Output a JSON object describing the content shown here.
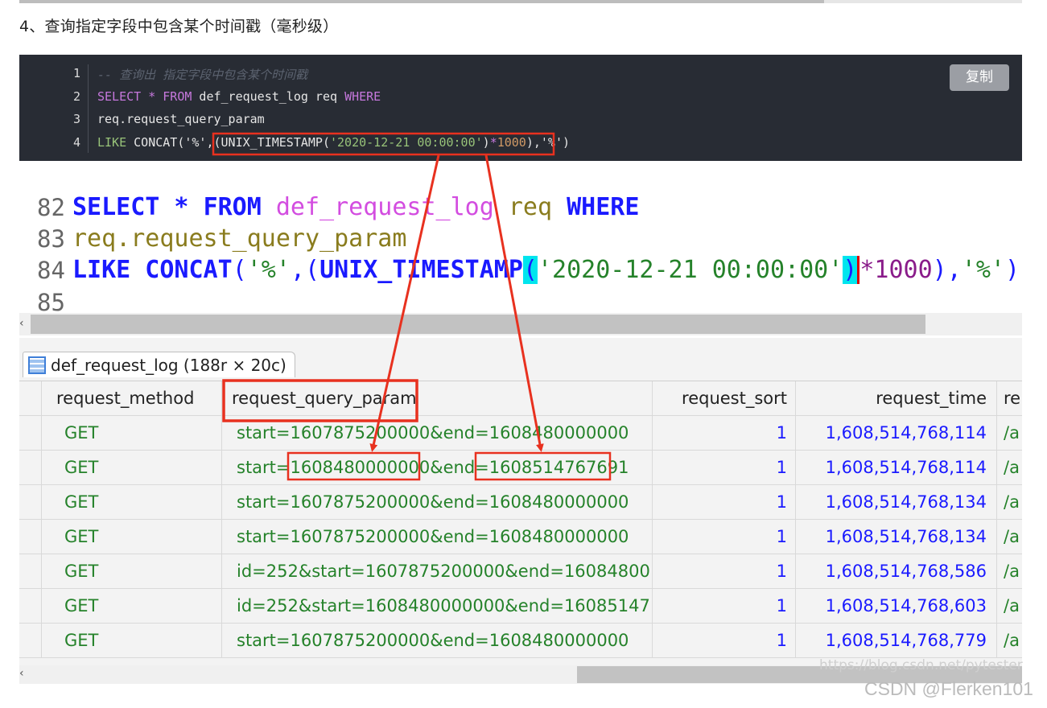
{
  "heading": "4、查询指定字段中包含某个时间戳（毫秒级）",
  "code_block": {
    "copy_label": "复制",
    "line_numbers": [
      "1",
      "2",
      "3",
      "4"
    ],
    "line1_comment": "-- 查询出 指定字段中包含某个时间戳",
    "line2": {
      "kw1": "SELECT",
      "star": " * ",
      "kw2": "FROM",
      "rest": " def_request_log req ",
      "kw3": "WHERE"
    },
    "line3": "req.request_query_param",
    "line4": {
      "kw": "LIKE",
      "pre": " CONCAT('%',(",
      "fn": "UNIX_TIMESTAMP(",
      "str": "'2020-12-21 00:00:00'",
      "close": ")",
      "mul": "*",
      "num": "1000",
      "post": "),'%')"
    }
  },
  "editor": {
    "line_numbers": [
      "82",
      "83",
      "84",
      "85"
    ],
    "line82": {
      "kw1": "SELECT",
      "star": " * ",
      "kw2": "FROM",
      "tbl": " def_request_log",
      "ident": " req",
      "kw3": " WHERE"
    },
    "line83": "req.request_query_param",
    "line84": {
      "kw": "LIKE CONCAT",
      "p1": "(",
      "s1": "'%'",
      "p2": ",(",
      "fn": "UNIX_TIMESTAMP",
      "p3": "(",
      "s2": "'2020-12-21 00:00:00'",
      "p4": ")",
      "num": "*1000",
      "p5": "),",
      "s3": "'%'",
      "p6": ")"
    }
  },
  "result_tab": {
    "label": "def_request_log (188r × 20c)"
  },
  "table": {
    "columns": [
      "request_method",
      "request_query_param",
      "request_sort",
      "request_time",
      "re"
    ],
    "rows": [
      [
        "GET",
        "start=1607875200000&end=1608480000000",
        "1",
        "1,608,514,768,114",
        "/a"
      ],
      [
        "GET",
        "start=1608480000000&end=1608514767691",
        "1",
        "1,608,514,768,114",
        "/a"
      ],
      [
        "GET",
        "start=1607875200000&end=1608480000000",
        "1",
        "1,608,514,768,134",
        "/a"
      ],
      [
        "GET",
        "start=1607875200000&end=1608480000000",
        "1",
        "1,608,514,768,134",
        "/a"
      ],
      [
        "GET",
        "id=252&start=1607875200000&end=16084800...",
        "1",
        "1,608,514,768,586",
        "/a"
      ],
      [
        "GET",
        "id=252&start=1608480000000&end=16085147...",
        "1",
        "1,608,514,768,603",
        "/a"
      ],
      [
        "GET",
        "start=1607875200000&end=1608480000000",
        "1",
        "1,608,514,768,779",
        "/a"
      ]
    ],
    "highlight_row2": {
      "pre": "start=",
      "v1": "1608480000000",
      "mid": "&end=",
      "v2": "1608514767691"
    }
  },
  "watermarks": {
    "blog": "https://blog.csdn.net/pytester",
    "csdn": "CSDN @Flerken101"
  },
  "colors": {
    "annotation_red": "#e8311f",
    "code_bg": "#282c34",
    "cyan_highlight": "#00e5ee"
  }
}
